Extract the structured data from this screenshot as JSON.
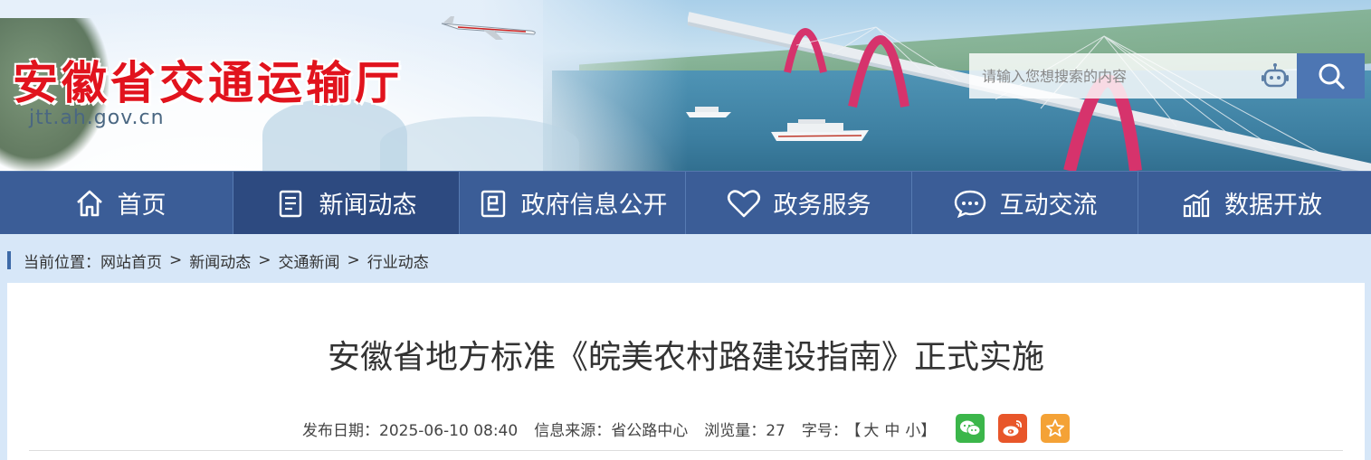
{
  "site": {
    "title": "安徽省交通运输厅",
    "domain": "jtt.ah.gov.cn"
  },
  "search": {
    "placeholder": "请输入您想搜索的内容"
  },
  "nav": [
    {
      "label": "首页",
      "icon": "home-icon"
    },
    {
      "label": "新闻动态",
      "icon": "news-icon",
      "active": true
    },
    {
      "label": "政府信息公开",
      "icon": "info-public-icon"
    },
    {
      "label": "政务服务",
      "icon": "heart-icon"
    },
    {
      "label": "互动交流",
      "icon": "chat-icon"
    },
    {
      "label": "数据开放",
      "icon": "chart-icon"
    }
  ],
  "breadcrumb": {
    "prefix": "当前位置：",
    "items": [
      "网站首页",
      "新闻动态",
      "交通新闻",
      "行业动态"
    ],
    "separator": ">"
  },
  "article": {
    "title": "安徽省地方标准《皖美农村路建设指南》正式实施",
    "publish_label": "发布日期：",
    "publish_date": "2025-06-10 08:40",
    "source_label": "信息来源：",
    "source": "省公路中心",
    "views_label": "浏览量：",
    "views": "27",
    "font_label": "字号：",
    "font_open": "【",
    "font_large": "大",
    "font_medium": "中",
    "font_small": "小",
    "font_close": "】"
  },
  "share": [
    {
      "name": "wechat-share",
      "color": "#3bb64a"
    },
    {
      "name": "weibo-share",
      "color": "#e8562a"
    },
    {
      "name": "favorite-share",
      "color": "#f4a236"
    }
  ],
  "colors": {
    "nav_bg": "#3b5d97",
    "nav_active": "#2d4a80",
    "logo_red": "#e1131d",
    "search_btn": "#4d76b3",
    "page_bg": "#d7e7f8"
  }
}
